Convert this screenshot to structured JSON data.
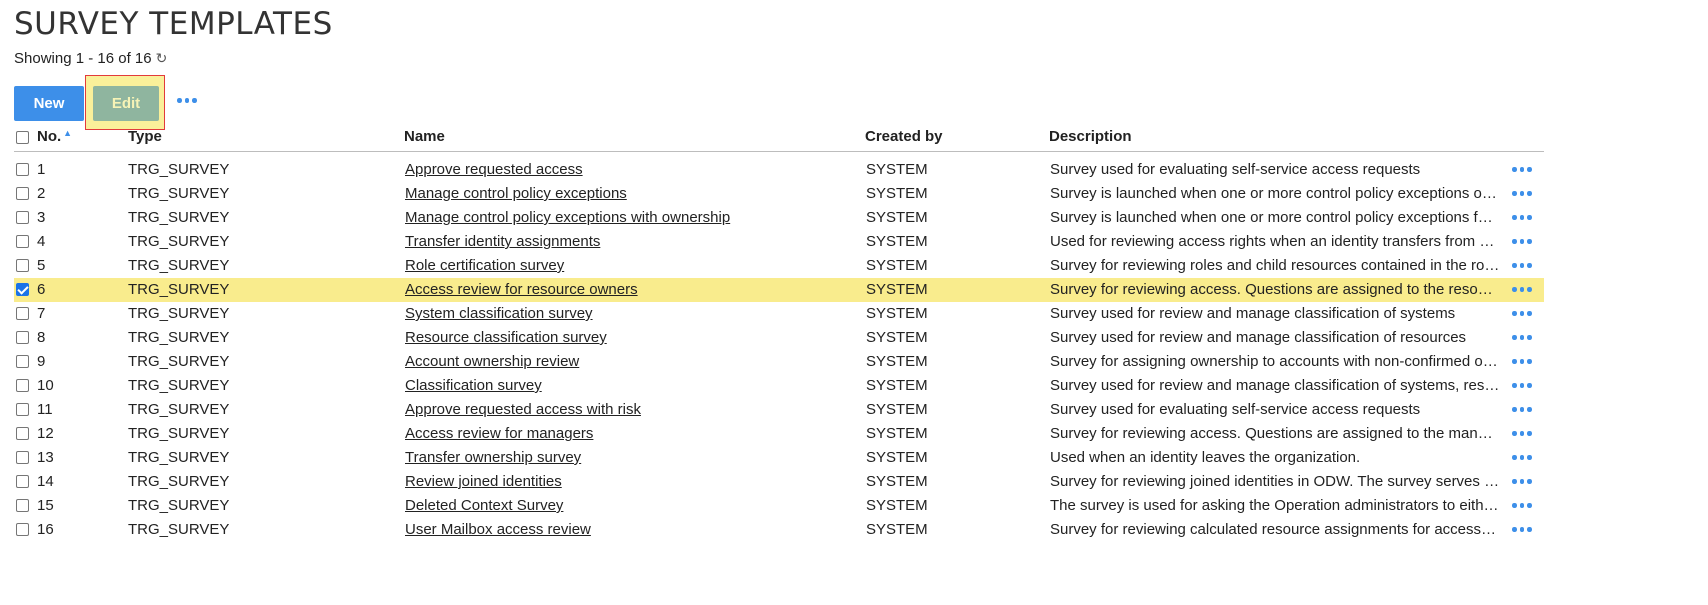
{
  "page": {
    "title": "SURVEY TEMPLATES",
    "showing": "Showing 1 - 16 of 16",
    "refresh_icon": "↻"
  },
  "toolbar": {
    "new_label": "New",
    "edit_label": "Edit"
  },
  "table": {
    "headers": {
      "no": "No.",
      "sort_icon": "▲",
      "type": "Type",
      "name": "Name",
      "created_by": "Created by",
      "description": "Description"
    },
    "rows": [
      {
        "no": "1",
        "type": "TRG_SURVEY",
        "name": "Approve requested access",
        "created_by": "SYSTEM",
        "description": "Survey used for evaluating self-service access requests",
        "checked": false
      },
      {
        "no": "2",
        "type": "TRG_SURVEY",
        "name": "Manage control policy exceptions",
        "created_by": "SYSTEM",
        "description": "Survey is launched when one or more control policy exceptions occu...",
        "checked": false
      },
      {
        "no": "3",
        "type": "TRG_SURVEY",
        "name": "Manage control policy exceptions with ownership",
        "created_by": "SYSTEM",
        "description": "Survey is launched when one or more control policy exceptions for p...",
        "checked": false
      },
      {
        "no": "4",
        "type": "TRG_SURVEY",
        "name": "Transfer identity assignments",
        "created_by": "SYSTEM",
        "description": "Used for reviewing access rights when an identity transfers from one...",
        "checked": false
      },
      {
        "no": "5",
        "type": "TRG_SURVEY",
        "name": "Role certification survey",
        "created_by": "SYSTEM",
        "description": "Survey for reviewing roles and child resources contained in the roles.",
        "checked": false
      },
      {
        "no": "6",
        "type": "TRG_SURVEY",
        "name": "Access review for resource owners",
        "created_by": "SYSTEM",
        "description": "Survey for reviewing access. Questions are assigned to the resource ...",
        "checked": true
      },
      {
        "no": "7",
        "type": "TRG_SURVEY",
        "name": "System classification survey",
        "created_by": "SYSTEM",
        "description": "Survey used for review and manage classification of systems",
        "checked": false
      },
      {
        "no": "8",
        "type": "TRG_SURVEY",
        "name": "Resource classification survey",
        "created_by": "SYSTEM",
        "description": "Survey used for review and manage classification of resources",
        "checked": false
      },
      {
        "no": "9",
        "type": "TRG_SURVEY",
        "name": "Account ownership review",
        "created_by": "SYSTEM",
        "description": "Survey for assigning ownership to accounts with non-confirmed own...",
        "checked": false
      },
      {
        "no": "10",
        "type": "TRG_SURVEY",
        "name": "Classification survey",
        "created_by": "SYSTEM",
        "description": "Survey used for review and manage classification of systems, resourc...",
        "checked": false
      },
      {
        "no": "11",
        "type": "TRG_SURVEY",
        "name": "Approve requested access with risk",
        "created_by": "SYSTEM",
        "description": "Survey used for evaluating self-service access requests",
        "checked": false
      },
      {
        "no": "12",
        "type": "TRG_SURVEY",
        "name": "Access review for managers",
        "created_by": "SYSTEM",
        "description": "Survey for reviewing access. Questions are assigned to the managers...",
        "checked": false
      },
      {
        "no": "13",
        "type": "TRG_SURVEY",
        "name": "Transfer ownership survey",
        "created_by": "SYSTEM",
        "description": "Used when an identity leaves the organization.",
        "checked": false
      },
      {
        "no": "14",
        "type": "TRG_SURVEY",
        "name": "Review joined identities",
        "created_by": "SYSTEM",
        "description": "Survey for reviewing joined identities in ODW. The survey serves the ...",
        "checked": false
      },
      {
        "no": "15",
        "type": "TRG_SURVEY",
        "name": "Deleted Context Survey",
        "created_by": "SYSTEM",
        "description": "The survey is used for asking the Operation administrators to either ...",
        "checked": false
      },
      {
        "no": "16",
        "type": "TRG_SURVEY",
        "name": "User Mailbox access review",
        "created_by": "SYSTEM",
        "description": "Survey for reviewing calculated resource assignments for access to E...",
        "checked": false
      }
    ]
  },
  "colors": {
    "accent": "#3d8fe9",
    "selected_row": "#f9ec8d",
    "edit_button": "#8fb59f"
  }
}
